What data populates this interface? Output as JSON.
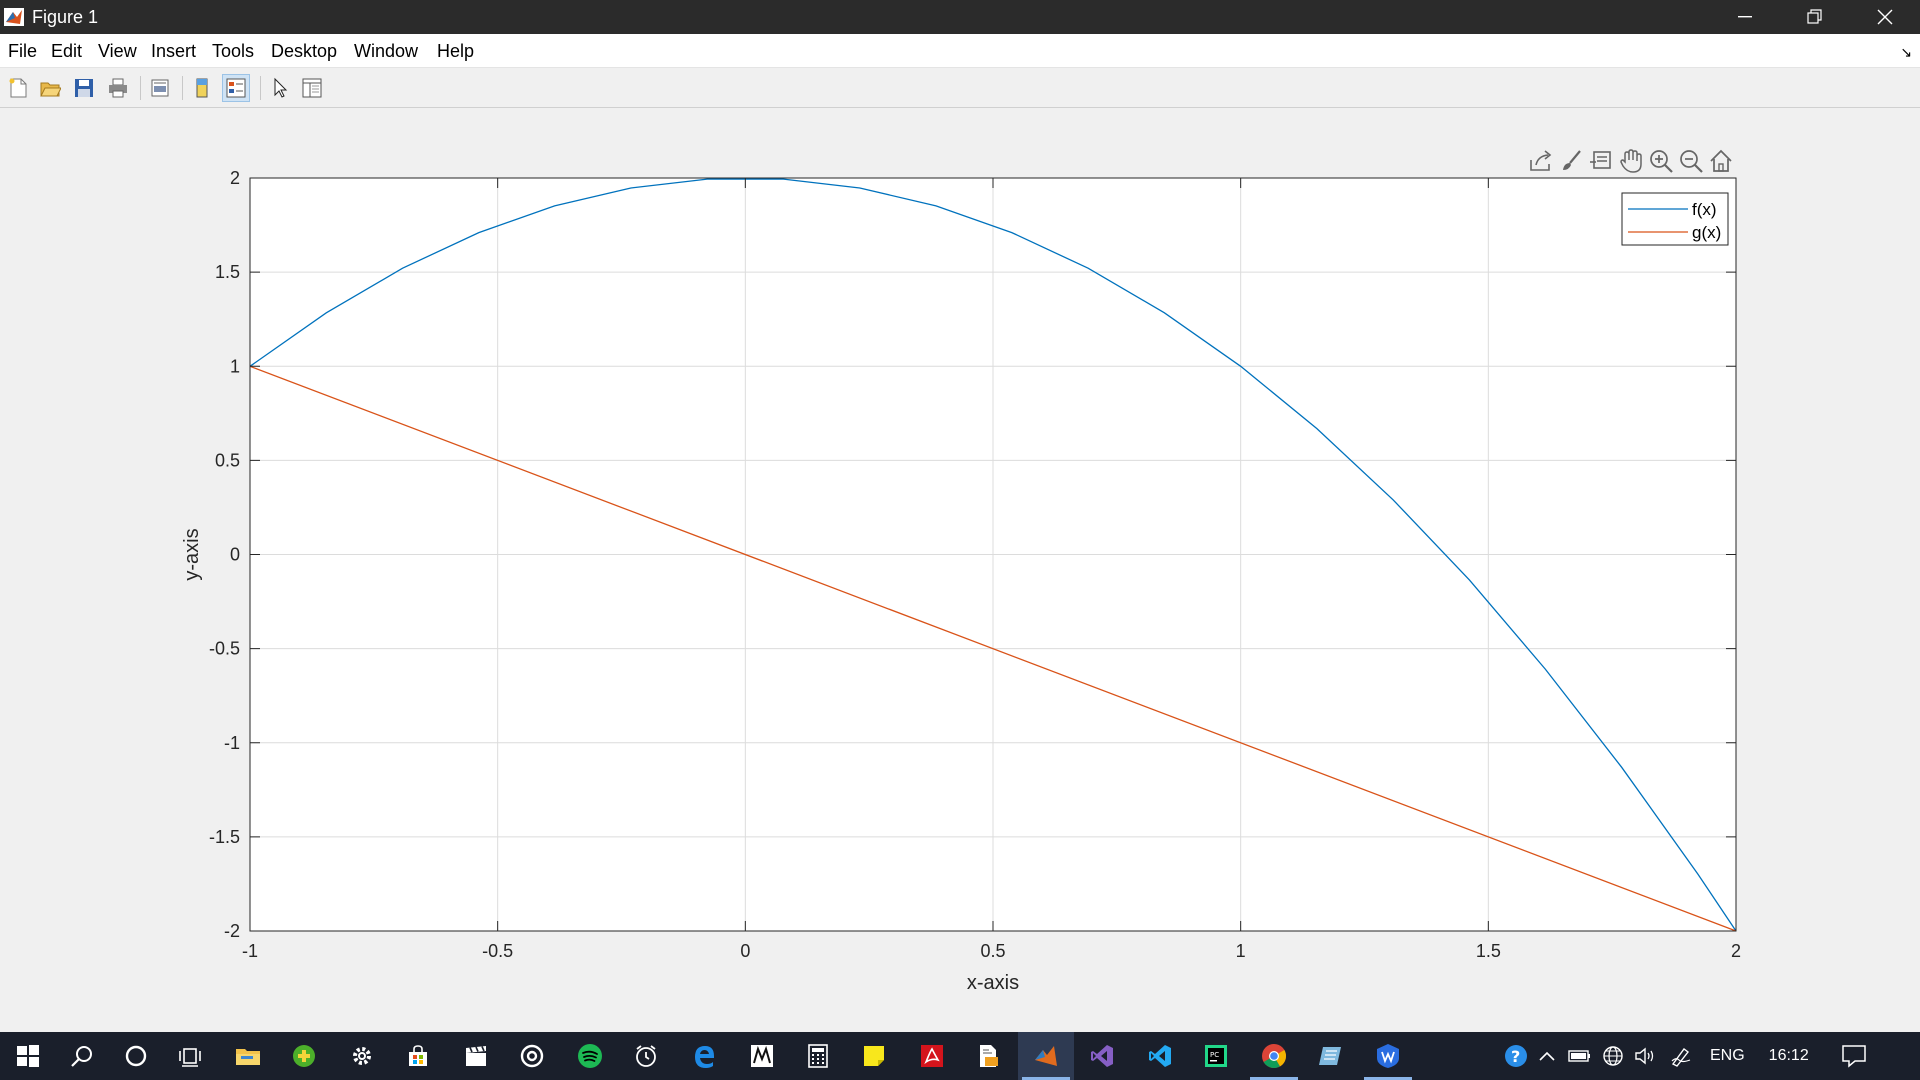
{
  "window": {
    "title": "Figure 1"
  },
  "menu": [
    "File",
    "Edit",
    "View",
    "Insert",
    "Tools",
    "Desktop",
    "Window",
    "Help"
  ],
  "toolbar": {
    "buttons": [
      "new-figure-icon",
      "open-file-icon",
      "save-icon",
      "print-icon",
      "print-preview-icon",
      "colorbar-icon",
      "legend-icon",
      "edit-plot-arrow-icon",
      "property-inspector-icon"
    ]
  },
  "axes_toolbar": [
    "export-icon",
    "brush-icon",
    "data-tips-icon",
    "pan-hand-icon",
    "zoom-in-icon",
    "zoom-out-icon",
    "home-icon"
  ],
  "chart_data": {
    "type": "line",
    "title": "",
    "xlabel": "x-axis",
    "ylabel": "y-axis",
    "xlim": [
      -1,
      2
    ],
    "ylim": [
      -2,
      2
    ],
    "xticks": [
      -1,
      -0.5,
      0,
      0.5,
      1,
      1.5,
      2
    ],
    "yticks": [
      -2,
      -1.5,
      -1,
      -0.5,
      0,
      0.5,
      1,
      1.5,
      2
    ],
    "xtick_labels": [
      "-1",
      "-0.5",
      "0",
      "0.5",
      "1",
      "1.5",
      "2"
    ],
    "ytick_labels": [
      "-2",
      "-1.5",
      "-1",
      "-0.5",
      "0",
      "0.5",
      "1",
      "1.5",
      "2"
    ],
    "grid": true,
    "legend_position": "top-right",
    "series": [
      {
        "name": "f(x)",
        "color": "#0072BD",
        "x": [
          -1,
          -0.846,
          -0.692,
          -0.538,
          -0.385,
          -0.231,
          -0.077,
          0.077,
          0.231,
          0.385,
          0.538,
          0.692,
          0.846,
          1,
          1.154,
          1.308,
          1.462,
          1.615,
          1.769,
          1.923,
          2
        ],
        "y": [
          1,
          1.284,
          1.521,
          1.71,
          1.852,
          1.947,
          1.994,
          1.994,
          1.947,
          1.852,
          1.71,
          1.521,
          1.284,
          1,
          0.669,
          0.29,
          -0.136,
          -0.609,
          -1.13,
          -1.698,
          -2
        ]
      },
      {
        "name": "g(x)",
        "color": "#D95319",
        "x": [
          -1,
          2
        ],
        "y": [
          1,
          -2
        ]
      }
    ]
  },
  "taskbar": {
    "apps": [
      "windows-start-icon",
      "search-icon",
      "cortana-icon",
      "task-view-icon",
      "file-explorer-icon",
      "plus-app-icon",
      "settings-icon",
      "store-icon",
      "clapper-icon",
      "media-icon",
      "spotify-icon",
      "alarm-clock-icon",
      "edge-icon",
      "matlab-doc-icon",
      "calculator-icon",
      "sticky-notes-icon",
      "acrobat-icon",
      "pdf-app-icon",
      "matlab-icon",
      "visual-studio-icon",
      "vscode-icon",
      "pycharm-icon",
      "chrome-icon",
      "notes-app-icon",
      "wps-icon"
    ],
    "tray": {
      "language": "ENG",
      "time": "16:12"
    }
  }
}
